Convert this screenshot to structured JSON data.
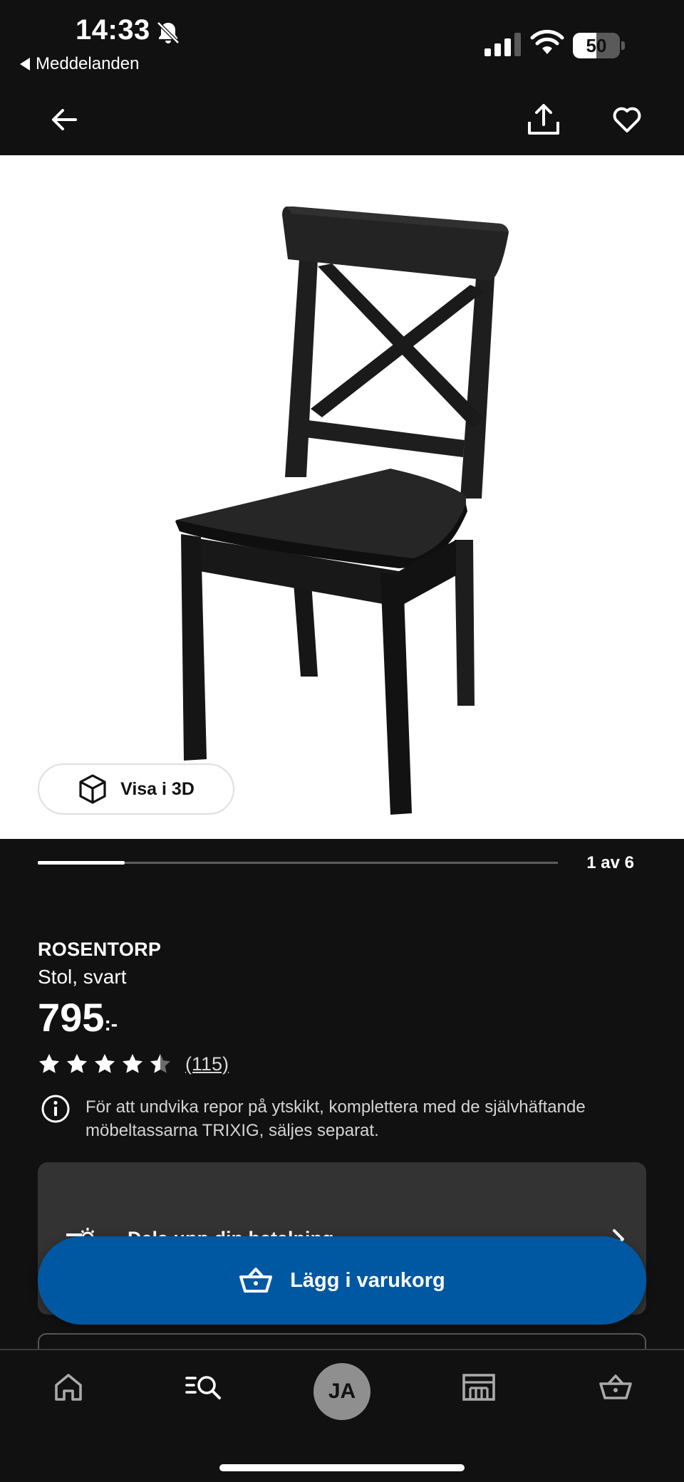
{
  "status_bar": {
    "time": "14:33",
    "back_app": "Meddelanden",
    "battery": "50",
    "battery_level": 0.5
  },
  "nav": {
    "back_icon": "arrow-left-icon",
    "share_icon": "share-icon",
    "favorite_icon": "heart-icon"
  },
  "gallery": {
    "view_3d_label": "Visa i 3D",
    "counter": "1 av 6",
    "progress_fraction": 0.1667
  },
  "product": {
    "name": "ROSENTORP",
    "description": "Stol, svart",
    "price": "795",
    "price_suffix": ":-",
    "rating": 4.5,
    "rating_max": 5,
    "reviews": "(115)",
    "note": "För att undvika repor på ytskikt, komplettera med de självhäftande möbeltassarna TRIXIG, säljes separat."
  },
  "payment": {
    "label": "Dela upp din betalning"
  },
  "cart": {
    "add_label": "Lägg i varukorg"
  },
  "tab_bar": {
    "avatar_initials": "JA",
    "items": [
      "home-icon",
      "search-icon",
      "profile-avatar",
      "store-icon",
      "cart-icon"
    ]
  },
  "colors": {
    "background": "#111111",
    "accent_blue": "#0058a3",
    "card": "#333333"
  }
}
